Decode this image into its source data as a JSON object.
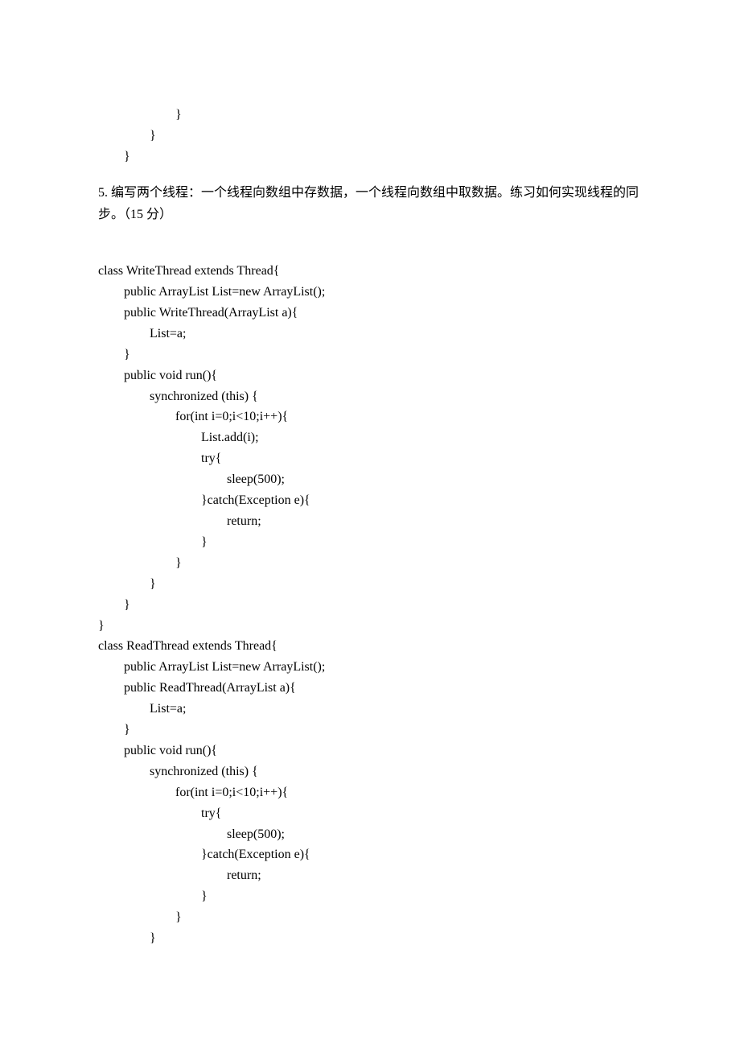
{
  "closing_braces": [
    "                        }",
    "                }",
    "        }"
  ],
  "question": {
    "number": "5.",
    "text": "编写两个线程：一个线程向数组中存数据，一个线程向数组中取数据。练习如何实现线程的同步。（15 分）"
  },
  "code_lines": [
    "class WriteThread extends Thread{",
    "        public ArrayList List=new ArrayList();",
    "        public WriteThread(ArrayList a){",
    "                List=a;",
    "        }",
    "        public void run(){",
    "                synchronized (this) {",
    "                        for(int i=0;i<10;i++){",
    "                                List.add(i);",
    "",
    "                                try{",
    "                                        sleep(500);",
    "                                }catch(Exception e){",
    "                                        return;",
    "                                }",
    "                        }",
    "                }",
    "        }",
    "}",
    "class ReadThread extends Thread{",
    "        public ArrayList List=new ArrayList();",
    "        public ReadThread(ArrayList a){",
    "                List=a;",
    "        }",
    "        public void run(){",
    "                synchronized (this) {",
    "                        for(int i=0;i<10;i++){",
    "",
    "                                try{",
    "                                        sleep(500);",
    "                                }catch(Exception e){",
    "                                        return;",
    "                                }",
    "                        }",
    "                }"
  ]
}
